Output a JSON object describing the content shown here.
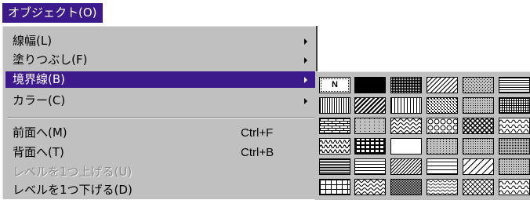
{
  "menubar": {
    "title": "オブジェクト(O)"
  },
  "menu": {
    "items": [
      {
        "label": "線幅(L)",
        "submenu": true,
        "selected": false,
        "disabled": false
      },
      {
        "label": "塗りつぶし(F)",
        "submenu": true,
        "selected": false,
        "disabled": false
      },
      {
        "label": "境界線(B)",
        "submenu": true,
        "selected": true,
        "disabled": false
      },
      {
        "label": "カラー(C)",
        "submenu": true,
        "selected": false,
        "disabled": false
      },
      {
        "label": "前面へ(M)",
        "shortcut": "Ctrl+F",
        "submenu": false,
        "selected": false,
        "disabled": false
      },
      {
        "label": "背面へ(T)",
        "shortcut": "Ctrl+B",
        "submenu": false,
        "selected": false,
        "disabled": false
      },
      {
        "label": "レベルを1つ上げる(U)",
        "submenu": false,
        "selected": false,
        "disabled": true
      },
      {
        "label": "レベルを1つ下げる(D)",
        "submenu": false,
        "selected": false,
        "disabled": false
      }
    ]
  },
  "palette": {
    "first_cell_label": "N",
    "patterns": [
      [
        "none",
        "solid",
        "dense-dots",
        "diag-right",
        "sparse-dots",
        "horizontal"
      ],
      [
        "vertical",
        "diag-wide",
        "vertical-wide",
        "checker-dots",
        "fine-dots",
        "grid"
      ],
      [
        "brick",
        "sparse-grid-dots",
        "zigzag-light",
        "circles",
        "diamond-weave",
        "scallop"
      ],
      [
        "waves",
        "bold-grid",
        "blank",
        "dots-medium",
        "dots-fine",
        "dots-large"
      ],
      [
        "dense-horizontal",
        "horizontal-medium",
        "diag-right-thin",
        "horizontal-wide",
        "diag-right-wide",
        "dots-fine"
      ],
      [
        "grid-large",
        "zigzag",
        "dots-dense",
        "wave-dots",
        "diag-cross-light",
        "scallop"
      ]
    ]
  }
}
